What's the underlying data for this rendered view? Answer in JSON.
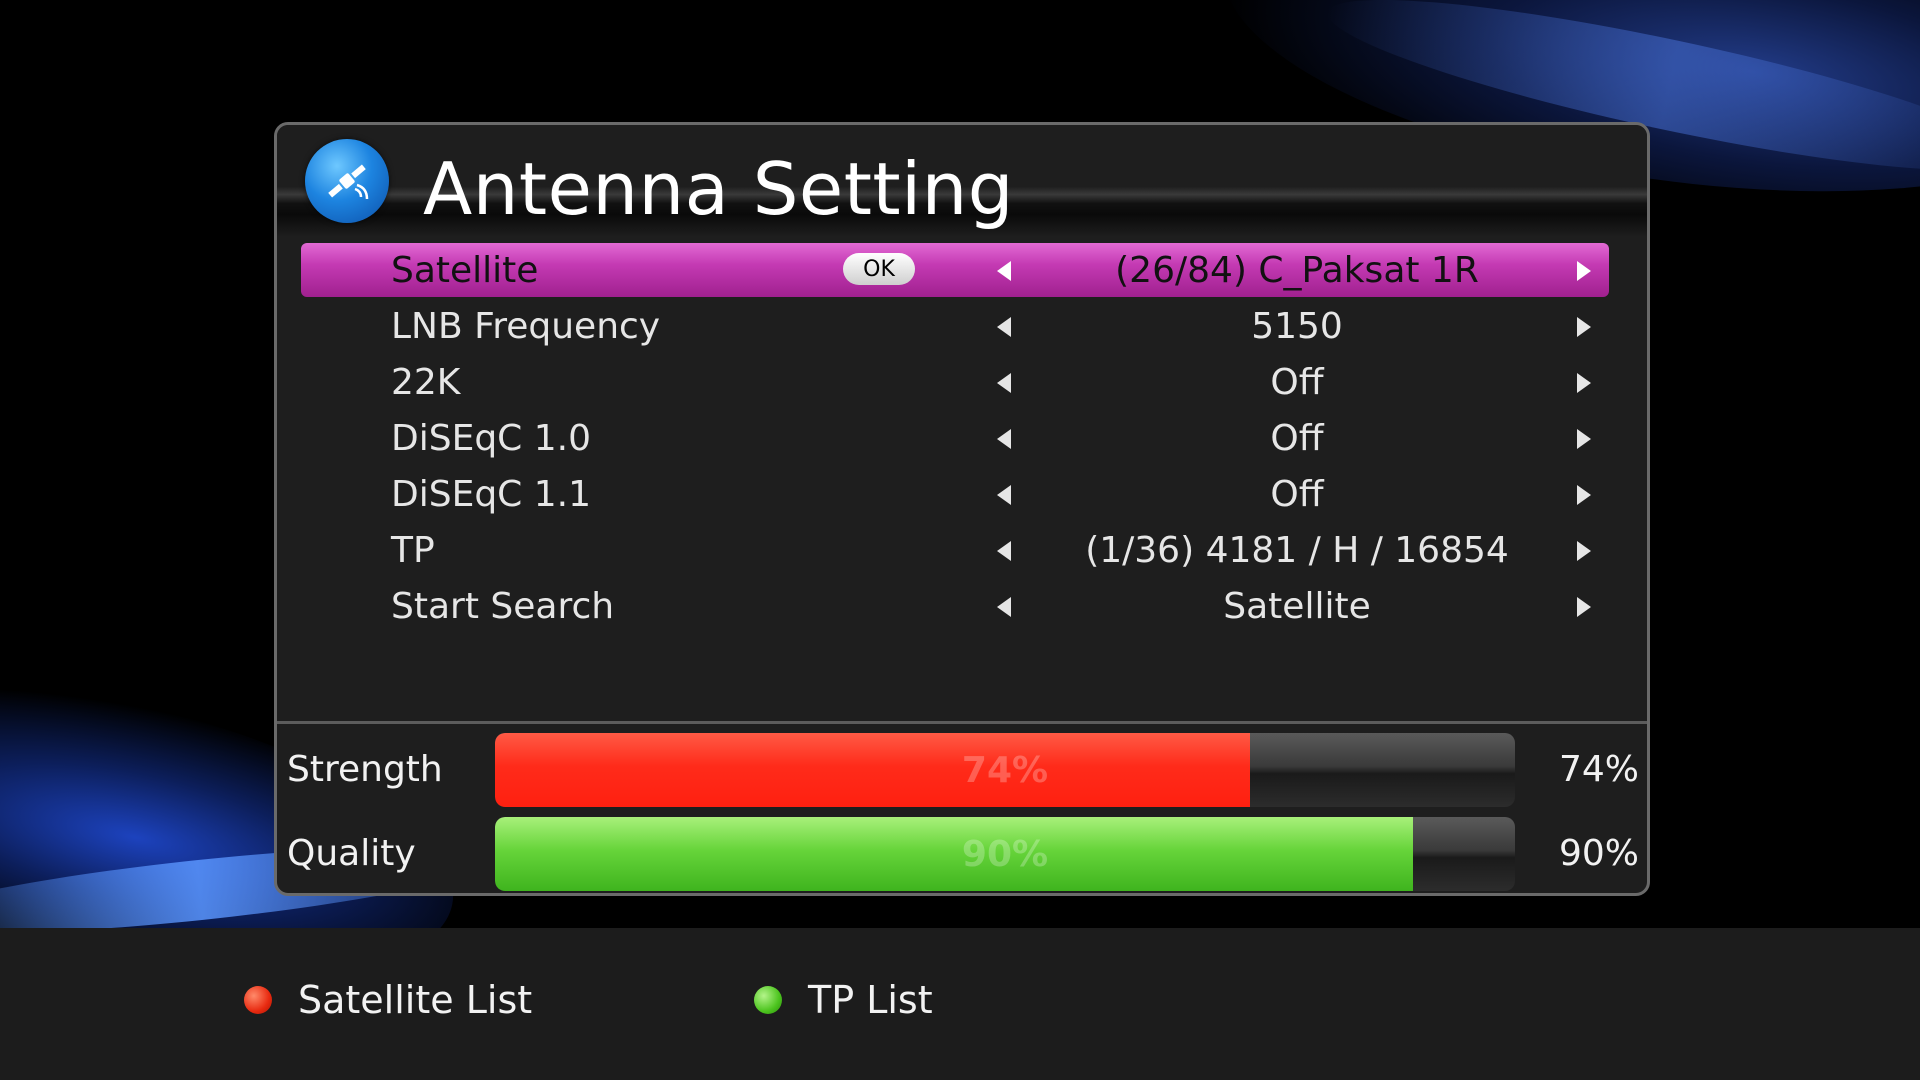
{
  "title": "Antenna Setting",
  "title_icon": "satellite-icon",
  "menu": [
    {
      "label": "Satellite",
      "ok": "OK",
      "value": "(26/84) C_Paksat 1R",
      "selected": true
    },
    {
      "label": "LNB Frequency",
      "value": "5150"
    },
    {
      "label": "22K",
      "value": "Off"
    },
    {
      "label": "DiSEqC 1.0",
      "value": "Off"
    },
    {
      "label": "DiSEqC 1.1",
      "value": "Off"
    },
    {
      "label": "TP",
      "value": "(1/36) 4181 / H / 16854"
    },
    {
      "label": "Start Search",
      "value": "Satellite"
    }
  ],
  "signal": {
    "strength": {
      "label": "Strength",
      "percent": 74,
      "bar_text": "74%",
      "text": "74%",
      "color": "#ff2b1a"
    },
    "quality": {
      "label": "Quality",
      "percent": 90,
      "bar_text": "90%",
      "text": "90%",
      "color": "#66d43a"
    }
  },
  "footer": {
    "red": {
      "label": "Satellite List",
      "color": "#e82a10"
    },
    "green": {
      "label": "TP List",
      "color": "#4cc41e"
    }
  },
  "colors": {
    "highlight": "#c43ab3",
    "panel": "#1e1e1e"
  }
}
